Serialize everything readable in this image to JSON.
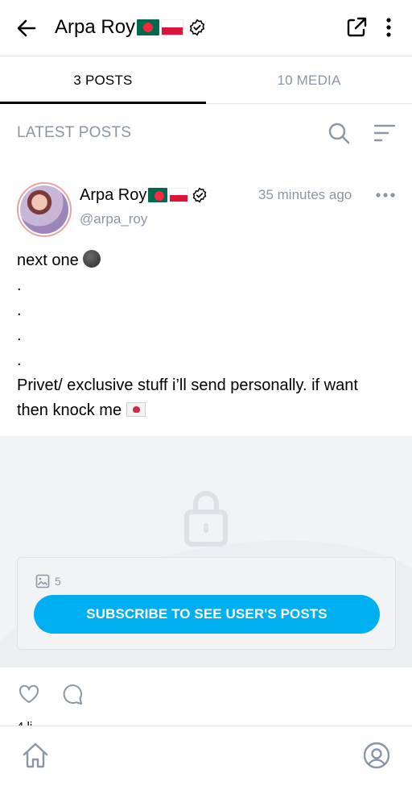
{
  "header": {
    "title": "Arpa Roy",
    "flags": [
      "flag-bangladesh",
      "flag-poland"
    ],
    "icons": {
      "back": "arrow-left-icon",
      "verified": "verified-badge-icon",
      "share": "share-icon",
      "menu": "more-vertical-icon"
    }
  },
  "tabs": [
    {
      "label": "3 POSTS",
      "active": true
    },
    {
      "label": "10 MEDIA",
      "active": false
    }
  ],
  "section": {
    "title": "LATEST POSTS",
    "icons": {
      "search": "search-icon",
      "sort": "sort-icon"
    }
  },
  "post": {
    "author": "Arpa Roy",
    "handle": "@arpa_roy",
    "time": "35 minutes ago",
    "text_lines": [
      "next one",
      ".",
      ".",
      ".",
      ".",
      "Privet/ exclusive stuff i’ll send personally. if want",
      "then knock me"
    ],
    "emoji": {
      "line1": "smiling-face-dark",
      "line7": "love-letter"
    },
    "locked": {
      "media_count": "5",
      "subscribe_label": "SUBSCRIBE TO SEE USER'S POSTS"
    },
    "likes_partial": "4 li"
  },
  "colors": {
    "accent": "#00aff0",
    "muted": "#8a96a3",
    "divider": "#e3e6ea",
    "locked_bg": "#f1f3f5"
  }
}
